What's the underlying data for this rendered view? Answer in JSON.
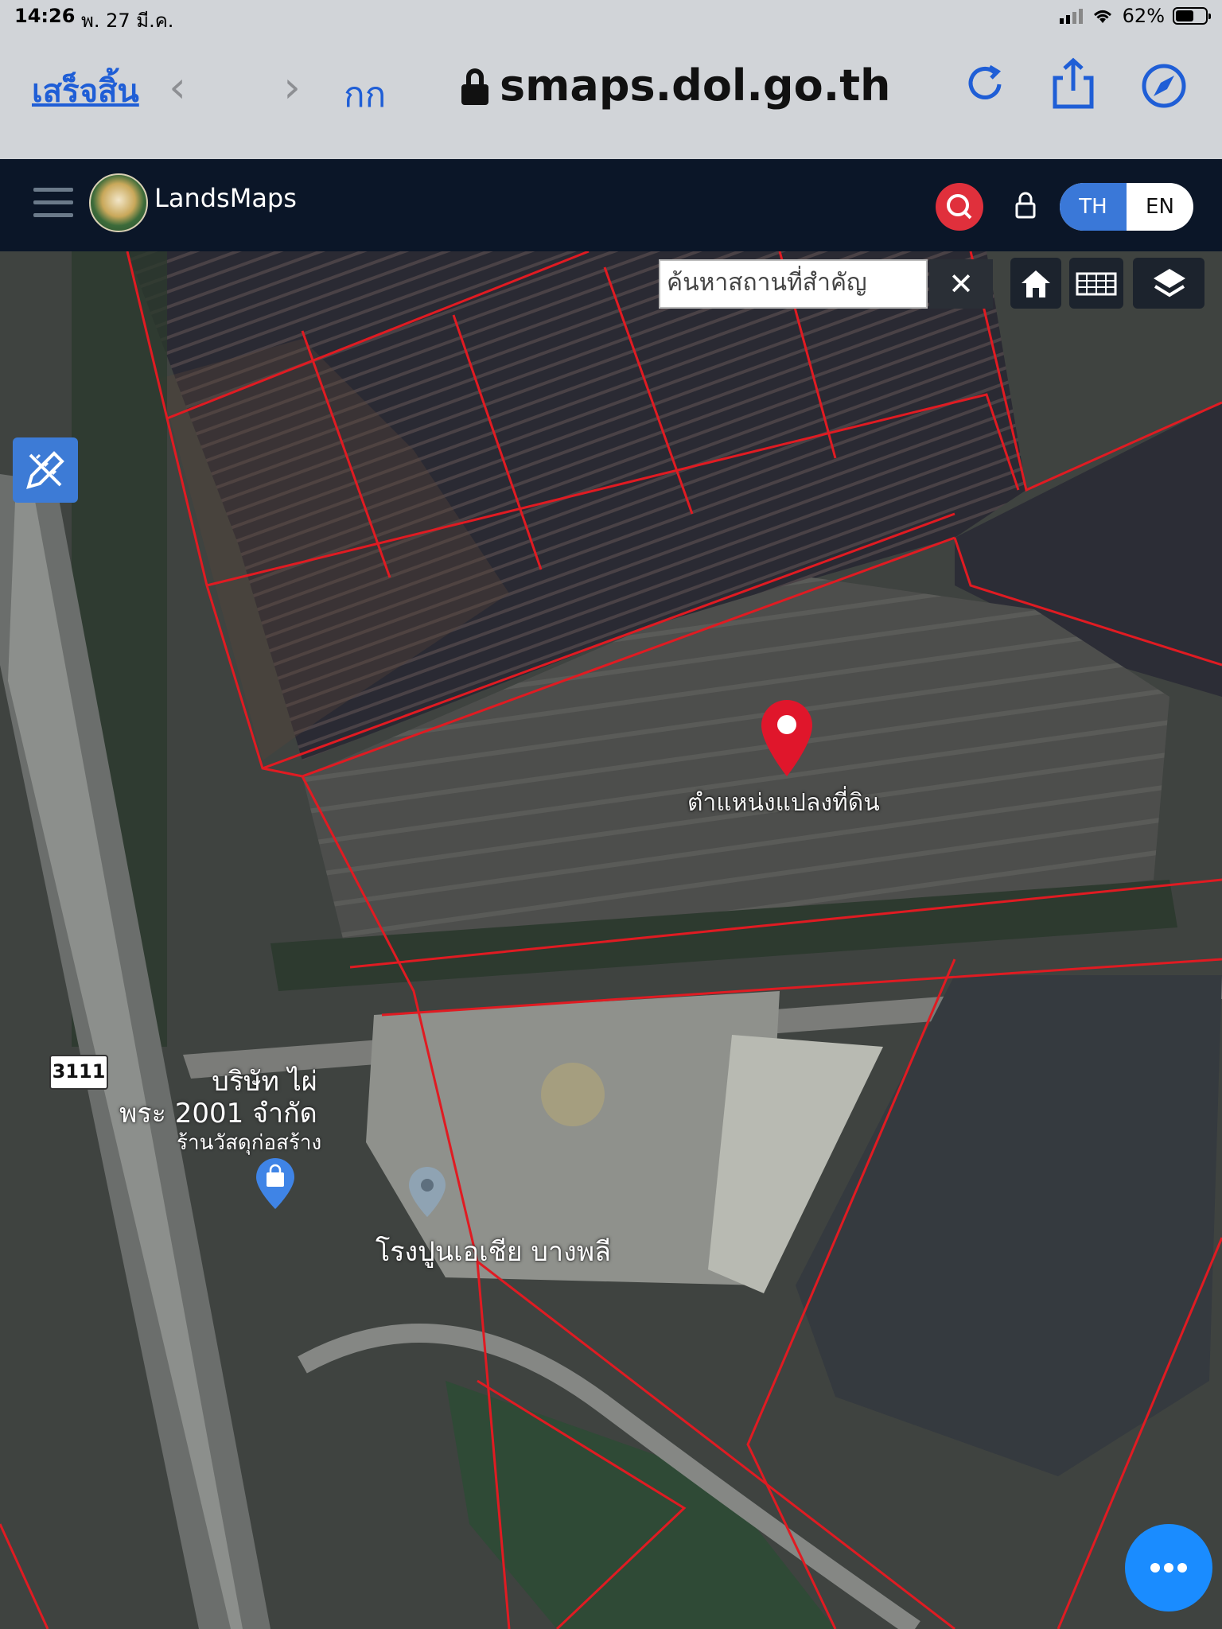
{
  "status": {
    "time": "14:26",
    "date": "พ. 27 มี.ค.",
    "battery": "62%",
    "battery_level": 0.62
  },
  "browser": {
    "done_label": "เสร็จสิ้น",
    "text_size_label": "กก",
    "url": "smaps.dol.go.th",
    "back_glyph": "‹",
    "forward_glyph": "›"
  },
  "app": {
    "brand": "LandsMaps",
    "lang_th": "TH",
    "lang_en": "EN",
    "accent": "#3a78d8",
    "search_color": "#e0303c"
  },
  "map": {
    "search_placeholder": "ค้นหาสถานที่สำคัญ",
    "close_glyph": "✕",
    "parcel_label": "ตำแหน่งแปลงที่ดิน",
    "company_line1": "บริษัท ไผ่",
    "company_line2": "พระ 2001 จำกัด",
    "shop_label": "ร้านวัสดุก่อสร้าง",
    "plant_label": "โรงปูนเอเชีย บางพลี",
    "road_number": "3111",
    "boundary_color": "#e01b22"
  }
}
